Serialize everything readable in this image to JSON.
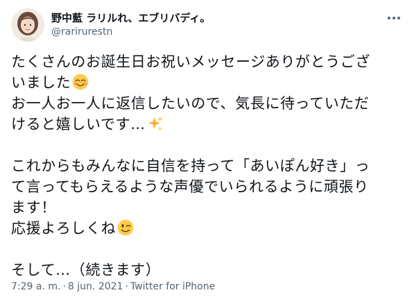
{
  "author": {
    "display_name": "野中藍 ラリルれ、エブリバディ。",
    "handle": "@rarirurestn"
  },
  "tweet": {
    "lines": [
      "たくさんのお誕生日お祝いメッセージありがとうござ",
      "いました",
      "お一人お一人に返信したいので、気長に待っていただ",
      "けると嬉しいです…",
      "",
      "これからもみんなに自信を持って「あいぽん好き」っ",
      "て言ってもらえるような声優でいられるように頑張り",
      "ます！",
      "応援よろしくね",
      "",
      "そして…（続きます）"
    ],
    "emojis": {
      "smiling_face": "smiling-face-with-smiling-eyes-icon",
      "sparkles": "sparkles-icon",
      "winking_face": "winking-face-icon"
    }
  },
  "meta": {
    "time": "7:29 a. m.",
    "separator": "·",
    "date": "8 jun. 2021",
    "source": "Twitter for iPhone"
  },
  "colors": {
    "text": "#0f1419",
    "secondary": "#536471"
  }
}
